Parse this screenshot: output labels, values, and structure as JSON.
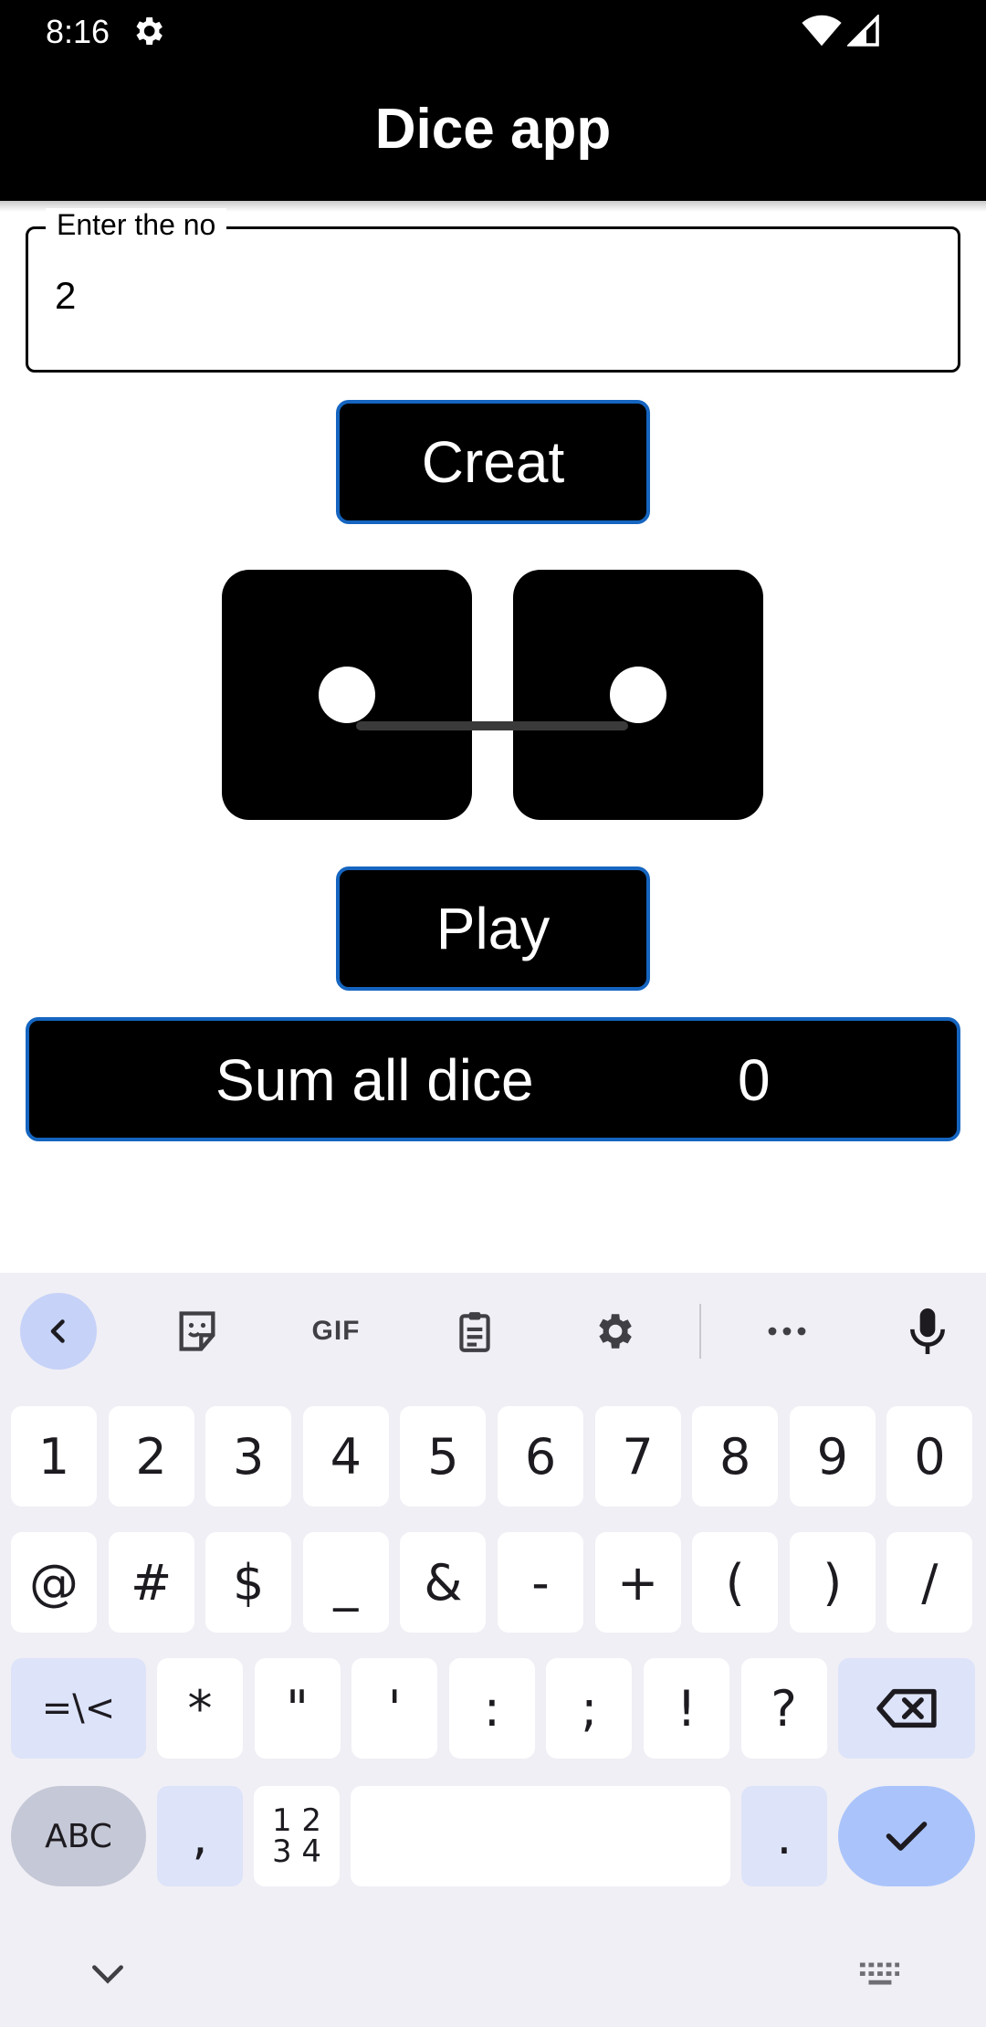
{
  "status_bar": {
    "time": "8:16",
    "icons": [
      "gear-icon",
      "wifi-icon",
      "signal-icon"
    ]
  },
  "app_bar": {
    "title": "Dice app"
  },
  "input": {
    "label": "Enter the no",
    "value": "2"
  },
  "buttons": {
    "create_label": "Creat",
    "play_label": "Play"
  },
  "dice": [
    {
      "face": 1
    },
    {
      "face": 1
    }
  ],
  "sum": {
    "label": "Sum all dice",
    "value": "0"
  },
  "colors": {
    "accent_border": "#1565c0",
    "keyboard_bg": "#f0eff5",
    "enter_key": "#aac4fb",
    "toolbar_back": "#c6d2f7"
  },
  "keyboard": {
    "toolbar": [
      "back-icon",
      "sticker-icon",
      "GIF",
      "clipboard-icon",
      "gear-icon",
      "more-icon",
      "mic-icon"
    ],
    "row1": [
      "1",
      "2",
      "3",
      "4",
      "5",
      "6",
      "7",
      "8",
      "9",
      "0"
    ],
    "row2": [
      "@",
      "#",
      "$",
      "_",
      "&",
      "-",
      "+",
      "(",
      ")",
      "/"
    ],
    "row3": [
      "=\\<",
      "*",
      "\"",
      "'",
      ":",
      ";",
      "!",
      "?"
    ],
    "row4": {
      "abc": "ABC",
      "comma": ",",
      "num_top": "1 2",
      "num_bottom": "3 4",
      "period": "."
    }
  }
}
